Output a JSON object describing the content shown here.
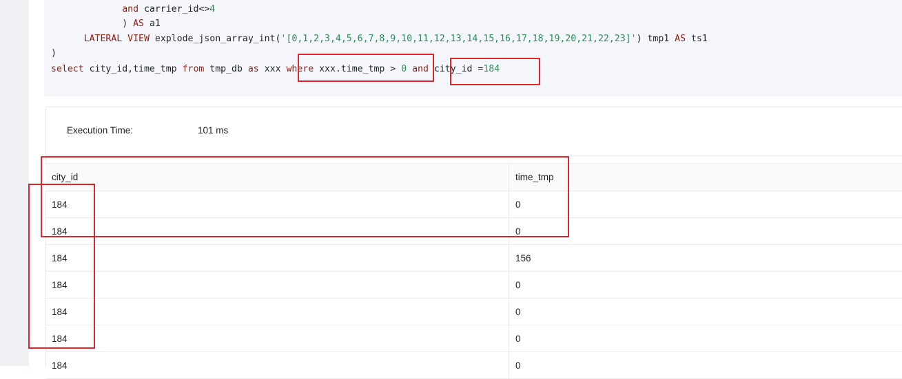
{
  "code": {
    "line1": {
      "indent": "             ",
      "kw": "and",
      "text": " carrier_id<>",
      "num": "4"
    },
    "line2": {
      "indent": "             ",
      "text": ") ",
      "kw": "AS",
      "tail": " a1"
    },
    "line3": {
      "indent": "      ",
      "kw1": "LATERAL",
      "sp": " ",
      "kw2": "VIEW",
      "fn": " explode_json_array_int(",
      "str": "'[0,1,2,3,4,5,6,7,8,9,10,11,12,13,14,15,16,17,18,19,20,21,22,23]'",
      "after": ") tmp1 ",
      "kw3": "AS",
      "tail": " ts1"
    },
    "line4": {
      "text": ")"
    },
    "line5": {
      "kw_select": "select",
      "cols": " city_id,time_tmp ",
      "kw_from": "from",
      "table": " tmp_db ",
      "kw_as": "as",
      "alias": " xxx ",
      "kw_where": "where",
      "cond": " xxx.time_tmp > ",
      "zero": "0",
      "sp": " ",
      "kw_and": "and",
      "cond2": " city_id =",
      "val": "184"
    }
  },
  "execution": {
    "label": "Execution Time:",
    "value": "101 ms"
  },
  "results": {
    "columns": [
      "city_id",
      "time_tmp"
    ],
    "rows": [
      [
        "184",
        "0"
      ],
      [
        "184",
        "0"
      ],
      [
        "184",
        "156"
      ],
      [
        "184",
        "0"
      ],
      [
        "184",
        "0"
      ],
      [
        "184",
        "0"
      ],
      [
        "184",
        "0"
      ]
    ]
  },
  "colors": {
    "highlight": "#e0262a",
    "keyword": "#8a1f11",
    "number": "#2e8b57"
  }
}
